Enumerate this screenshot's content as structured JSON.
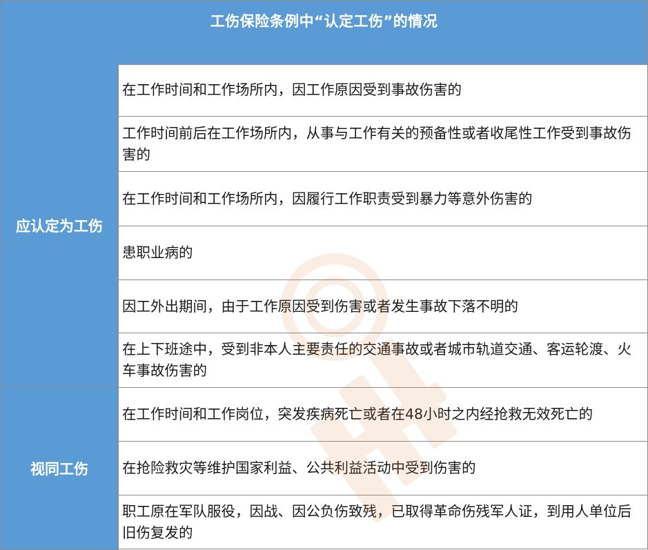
{
  "table": {
    "title": "工伤保险条例中“认定工伤”的情况",
    "groups": [
      {
        "category": "应认定为工伤",
        "rows": [
          "在工作时间和工作场所内，因工作原因受到事故伤害的",
          "工作时间前后在工作场所内，从事与工作有关的预备性或者收尾性工作受到事故伤害的",
          "在工作时间和工作场所内，因履行工作职责受到暴力等意外伤害的",
          "患职业病的",
          "因工外出期间，由于工作原因受到伤害或者发生事故下落不明的",
          "在上下班途中，受到非本人主要责任的交通事故或者城市轨道交通、客运轮渡、火车事故伤害的"
        ]
      },
      {
        "category": "视同工伤",
        "rows": [
          "在工作时间和工作岗位，突发疾病死亡或者在48小时之内经抢救无效死亡的",
          "在抢险救灾等维护国家利益、公共利益活动中受到伤害的",
          "职工原在军队服役，因战、因公负伤致残，已取得革命伤残军人证，到用人单位后旧伤复发的"
        ]
      }
    ]
  },
  "colors": {
    "header_bg": "#5b9bd5",
    "header_text": "#ffffff",
    "border": "#8a8a8a",
    "watermark": "#e07a2e"
  },
  "watermark": {
    "text": "悟空保",
    "icon": "wukong-logo-icon"
  }
}
